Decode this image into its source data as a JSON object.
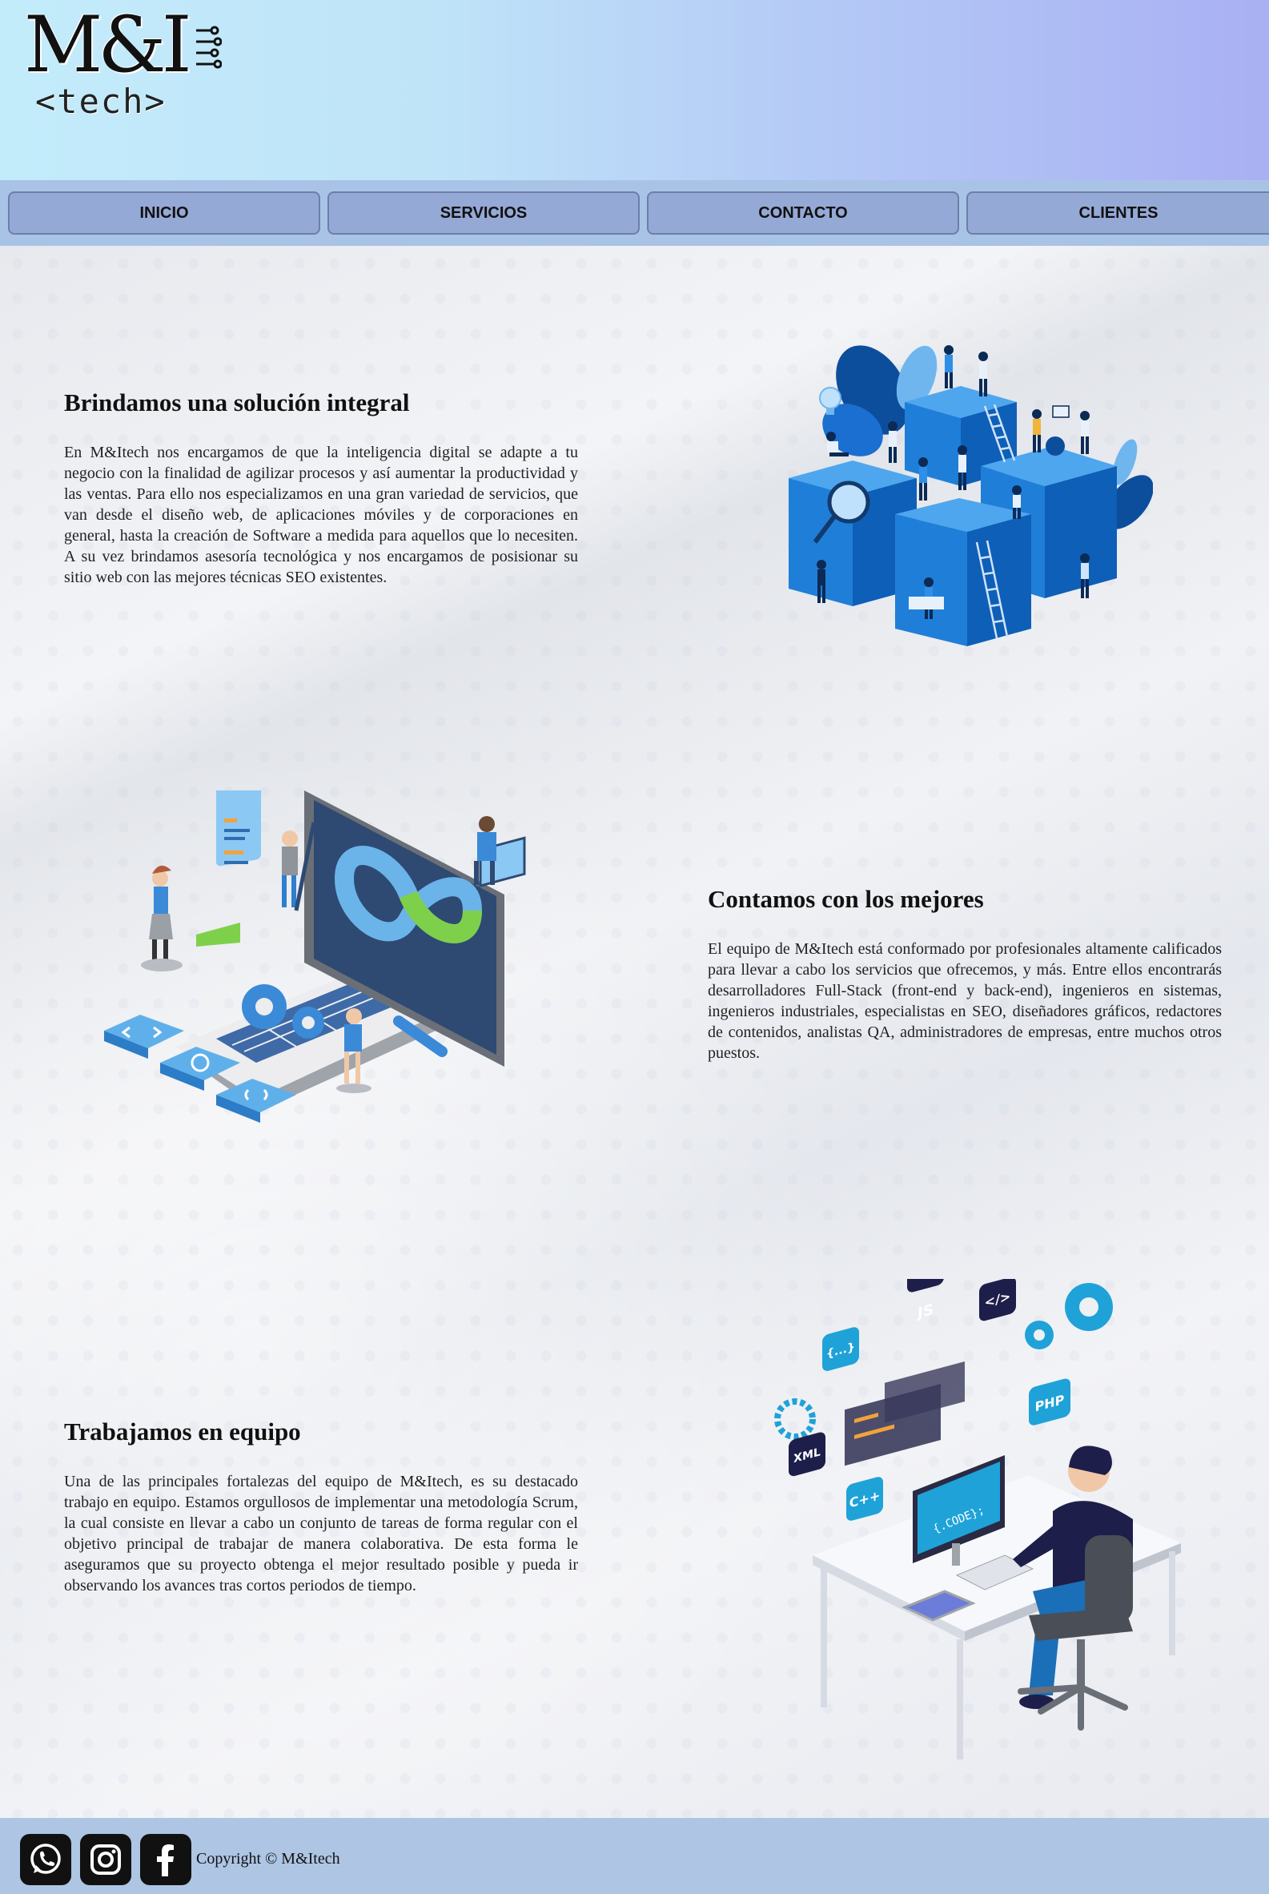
{
  "header": {
    "logo_text": "M&I",
    "logo_subtext": "<tech>",
    "gradient_colors": [
      "#c3ecfb",
      "#a9b0f3"
    ]
  },
  "nav": {
    "items": [
      {
        "label": "INICIO"
      },
      {
        "label": "SERVICIOS"
      },
      {
        "label": "CONTACTO"
      },
      {
        "label": "CLIENTES"
      }
    ]
  },
  "sections": [
    {
      "title": "Brindamos una solución integral",
      "text": "En M&Itech nos encargamos de que la inteligencia digital se adapte a tu negocio con la finalidad de agilizar procesos y así aumentar la productividad y las ventas. Para ello nos especializamos en una gran variedad de servicios, que van desde el diseño web, de aplicaciones móviles y de corporaciones en general, hasta la creación de Software a medida para aquellos que lo necesiten. A su vez brindamos asesoría tecnológica y nos encargamos de posisionar su sitio web con las mejores técnicas SEO existentes.",
      "illustration": "teamwork-blocks-illustration"
    },
    {
      "title": "Contamos con los mejores",
      "text": "El equipo de M&Itech está conformado por profesionales altamente calificados para llevar a cabo los servicios que ofrecemos, y más. Entre ellos encontrarás desarrolladores Full-Stack (front-end y back-end), ingenieros en sistemas, ingenieros industriales, especialistas en SEO, diseñadores gráficos, redactores de contenidos, analistas QA, administradores de empresas, entre muchos otros puestos.",
      "illustration": "devops-laptop-illustration"
    },
    {
      "title": "Trabajamos en equipo",
      "text": "Una de las principales fortalezas del equipo de M&Itech, es su destacado trabajo en equipo. Estamos orgullosos de implementar una metodología Scrum, la cual consiste en llevar a cabo un conjunto de tareas de forma regular con el objetivo principal de trabajar de manera colaborativa. De esta forma le aseguramos que su proyecto obtenga el mejor resultado posible y pueda ir observando los avances tras cortos periodos de tiempo.",
      "illustration": "developer-desk-illustration"
    }
  ],
  "illustration_labels": {
    "code_screen": "{.CODE};",
    "js": "JS",
    "php": "PHP",
    "xml": "XML",
    "cpp": "C++",
    "tag": "</>",
    "braces": "{...}"
  },
  "footer": {
    "social": [
      {
        "icon": "whatsapp-icon"
      },
      {
        "icon": "instagram-icon"
      },
      {
        "icon": "facebook-icon"
      }
    ],
    "copyright": "Copyright © M&Itech"
  },
  "colors": {
    "nav_bg": "#a9c3e6",
    "nav_button": "#95a9d6",
    "footer_bg": "#aec5e4",
    "accent_blue": "#1a7fd4"
  }
}
